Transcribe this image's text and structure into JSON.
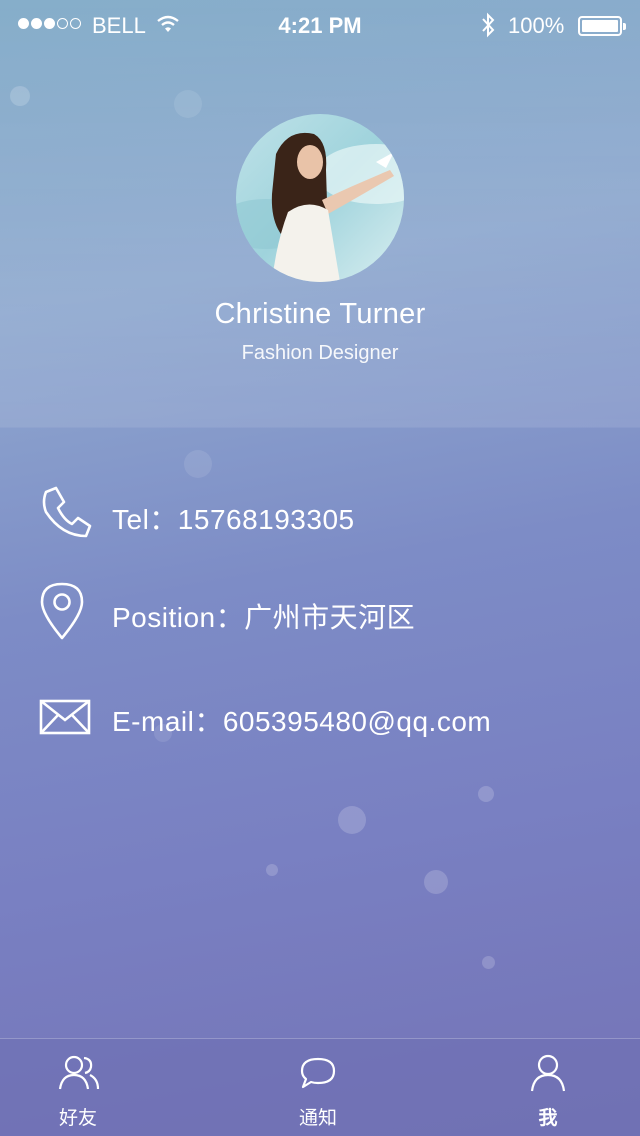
{
  "status_bar": {
    "carrier": "BELL",
    "time": "4:21 PM",
    "battery": "100%"
  },
  "profile": {
    "name": "Christine Turner",
    "title": "Fashion Designer"
  },
  "contacts": {
    "tel": "Tel：15768193305",
    "position": "Position：广州市天河区",
    "email": "E-mail：605395480@qq.com"
  },
  "tabs": [
    {
      "label": "好友",
      "icon": "friends-icon",
      "active": false
    },
    {
      "label": "通知",
      "icon": "chat-bubble-icon",
      "active": false
    },
    {
      "label": "我",
      "icon": "person-icon",
      "active": true
    }
  ],
  "colors": {
    "background_top": "#86aeca",
    "background_bottom": "#7473b6",
    "text": "#ffffff"
  }
}
